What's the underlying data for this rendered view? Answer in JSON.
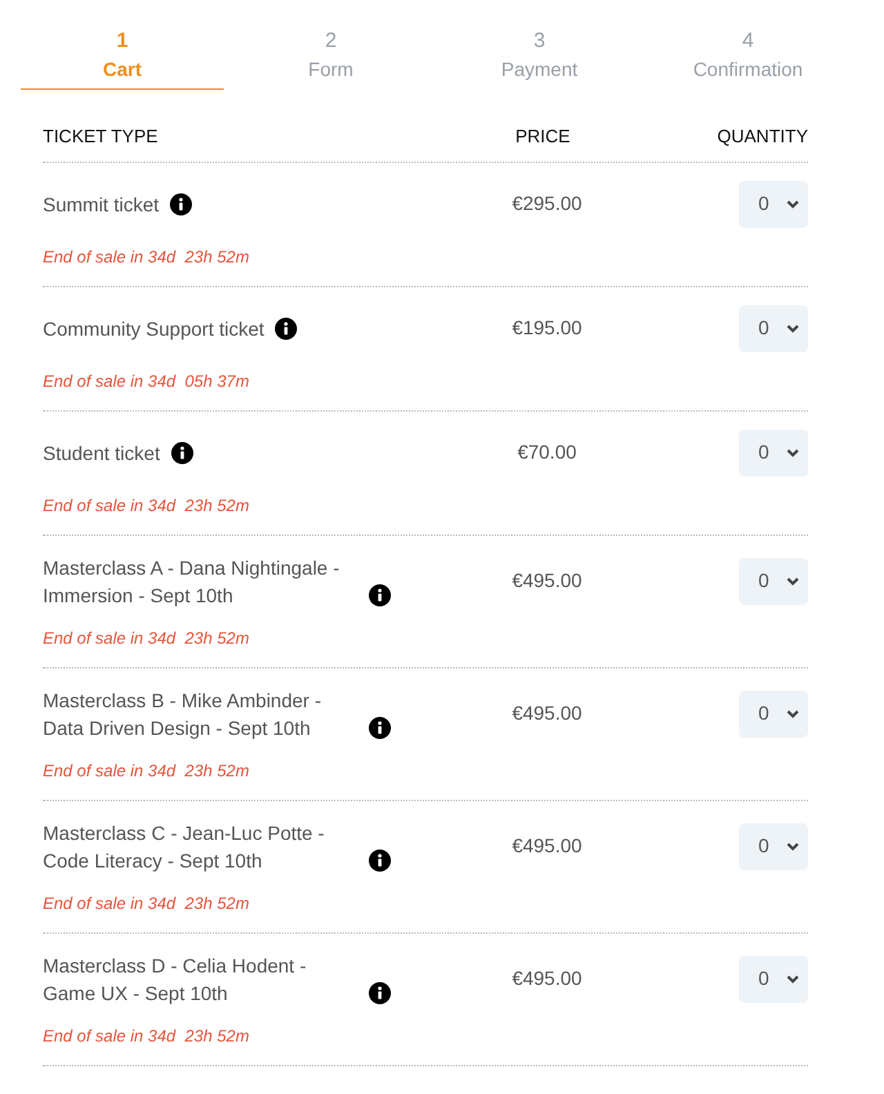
{
  "steps": [
    {
      "number": "1",
      "label": "Cart",
      "selected": true
    },
    {
      "number": "2",
      "label": "Form",
      "selected": false
    },
    {
      "number": "3",
      "label": "Payment",
      "selected": false
    },
    {
      "number": "4",
      "label": "Confirmation",
      "selected": false
    }
  ],
  "table": {
    "columns": [
      "TICKET TYPE",
      "PRICE",
      "QUANTITY"
    ],
    "rows": [
      {
        "name": "Summit ticket",
        "price": "€295.00",
        "quantity": "0",
        "note": "End of sale in 34d  23h 52m"
      },
      {
        "name": "Community Support ticket",
        "price": "€195.00",
        "quantity": "0",
        "note": "End of sale in 34d  05h 37m"
      },
      {
        "name": "Student ticket",
        "price": "€70.00",
        "quantity": "0",
        "note": "End of sale in 34d  23h 52m"
      },
      {
        "name": "Masterclass A - Dana Nightingale - Immersion - Sept 10th",
        "price": "€495.00",
        "quantity": "0",
        "note": "End of sale in 34d  23h 52m"
      },
      {
        "name": "Masterclass B - Mike Ambinder - Data Driven Design - Sept 10th",
        "price": "€495.00",
        "quantity": "0",
        "note": "End of sale in 34d  23h 52m"
      },
      {
        "name": "Masterclass C - Jean-Luc Potte - Code Literacy - Sept 10th",
        "price": "€495.00",
        "quantity": "0",
        "note": "End of sale in 34d  23h 52m"
      },
      {
        "name": "Masterclass D - Celia Hodent - Game UX - Sept 10th",
        "price": "€495.00",
        "quantity": "0",
        "note": "End of sale in 34d  23h 52m"
      }
    ]
  }
}
